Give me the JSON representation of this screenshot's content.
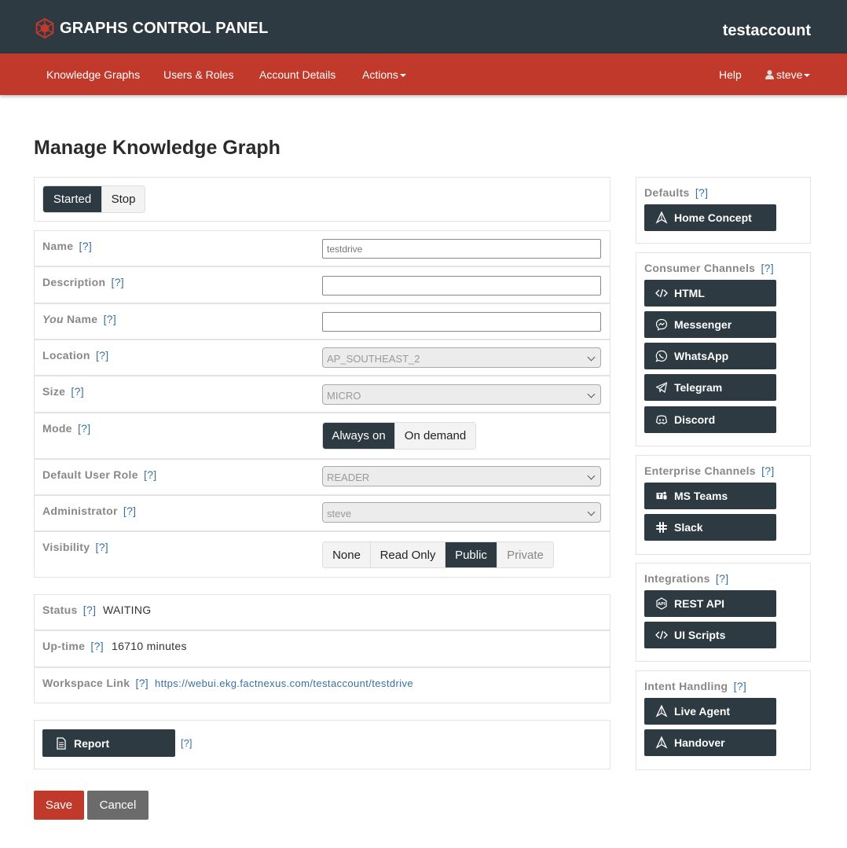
{
  "header": {
    "app_title": "GRAPHS CONTROL PANEL",
    "logo_icon": "graph-logo-icon",
    "account": "testaccount"
  },
  "nav": {
    "knowledge_graphs": "Knowledge Graphs",
    "users_roles": "Users & Roles",
    "account_details": "Account Details",
    "actions": "Actions",
    "help": "Help",
    "user": "steve"
  },
  "page_title": "Manage Knowledge Graph",
  "state_toggle": {
    "started": "Started",
    "stop": "Stop",
    "selected": "Started"
  },
  "help_marker": "[?]",
  "form": {
    "name": {
      "label": "Name",
      "value": "testdrive"
    },
    "description": {
      "label": "Description",
      "value": ""
    },
    "you_name": {
      "label_em": "You",
      "label_rest": " Name",
      "value": ""
    },
    "location": {
      "label": "Location",
      "value": "AP_SOUTHEAST_2"
    },
    "size": {
      "label": "Size",
      "value": "MICRO"
    },
    "mode": {
      "label": "Mode",
      "options": [
        "Always on",
        "On demand"
      ],
      "selected": "Always on"
    },
    "default_user_role": {
      "label": "Default User Role",
      "value": "READER"
    },
    "administrator": {
      "label": "Administrator",
      "value": "steve"
    },
    "visibility": {
      "label": "Visibility",
      "options": [
        "None",
        "Read Only",
        "Public",
        "Private"
      ],
      "selected": "Public"
    }
  },
  "info": {
    "status": {
      "label": "Status",
      "value": "WAITING"
    },
    "uptime": {
      "label": "Up-time",
      "value": "16710 minutes"
    },
    "workspace": {
      "label": "Workspace Link",
      "value": "https://webui.ekg.factnexus.com/testaccount/testdrive"
    }
  },
  "report_button": "Report",
  "actions": {
    "save": "Save",
    "cancel": "Cancel"
  },
  "sidebar": {
    "defaults": {
      "title": "Defaults",
      "buttons": [
        {
          "label": "Home Concept",
          "icon": "concept-icon"
        }
      ]
    },
    "consumer": {
      "title": "Consumer Channels",
      "buttons": [
        {
          "label": "HTML",
          "icon": "code-icon"
        },
        {
          "label": "Messenger",
          "icon": "messenger-icon"
        },
        {
          "label": "WhatsApp",
          "icon": "whatsapp-icon"
        },
        {
          "label": "Telegram",
          "icon": "telegram-icon"
        },
        {
          "label": "Discord",
          "icon": "discord-icon"
        }
      ]
    },
    "enterprise": {
      "title": "Enterprise Channels",
      "buttons": [
        {
          "label": "MS Teams",
          "icon": "teams-icon"
        },
        {
          "label": "Slack",
          "icon": "slack-icon"
        }
      ]
    },
    "integrations": {
      "title": "Integrations",
      "buttons": [
        {
          "label": "REST API",
          "icon": "api-icon"
        },
        {
          "label": "UI Scripts",
          "icon": "code-icon"
        }
      ]
    },
    "intent": {
      "title": "Intent Handling",
      "buttons": [
        {
          "label": "Live Agent",
          "icon": "concept-icon"
        },
        {
          "label": "Handover",
          "icon": "concept-icon"
        }
      ]
    }
  },
  "colors": {
    "header_bg": "#2d3a42",
    "nav_bg": "#c0392b",
    "primary_dark": "#2d3a42",
    "link": "#3a6fa0",
    "cancel": "#6b6b6b"
  }
}
